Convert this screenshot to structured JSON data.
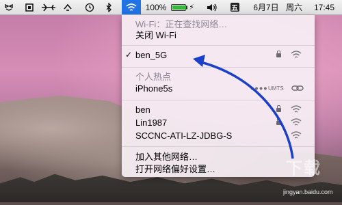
{
  "menubar": {
    "wifi_icon": "wifi-icon",
    "battery_percent": "100%",
    "battery_level": 1.0,
    "input_method": "五",
    "date": "6月7日",
    "weekday": "周六",
    "time": "17:45"
  },
  "wifi_menu": {
    "status": "Wi-Fi：正在查找网络…",
    "toggle_label": "关闭 Wi-Fi",
    "connected_network": "ben_5G",
    "hotspot_header": "个人热点",
    "hotspot_name": "iPhone5s",
    "hotspot_network": "UMTS",
    "networks": [
      {
        "name": "ben",
        "locked": true
      },
      {
        "name": "Lin1987",
        "locked": true
      },
      {
        "name": "SCCNC-ATI-LZ-JDBG-S",
        "locked": false
      }
    ],
    "join_other": "加入其他网络…",
    "open_prefs": "打开网络偏好设置…"
  },
  "overlay": {
    "watermark_url": "jingyan.baidu.com",
    "arrow_color": "#1a3fc8"
  }
}
